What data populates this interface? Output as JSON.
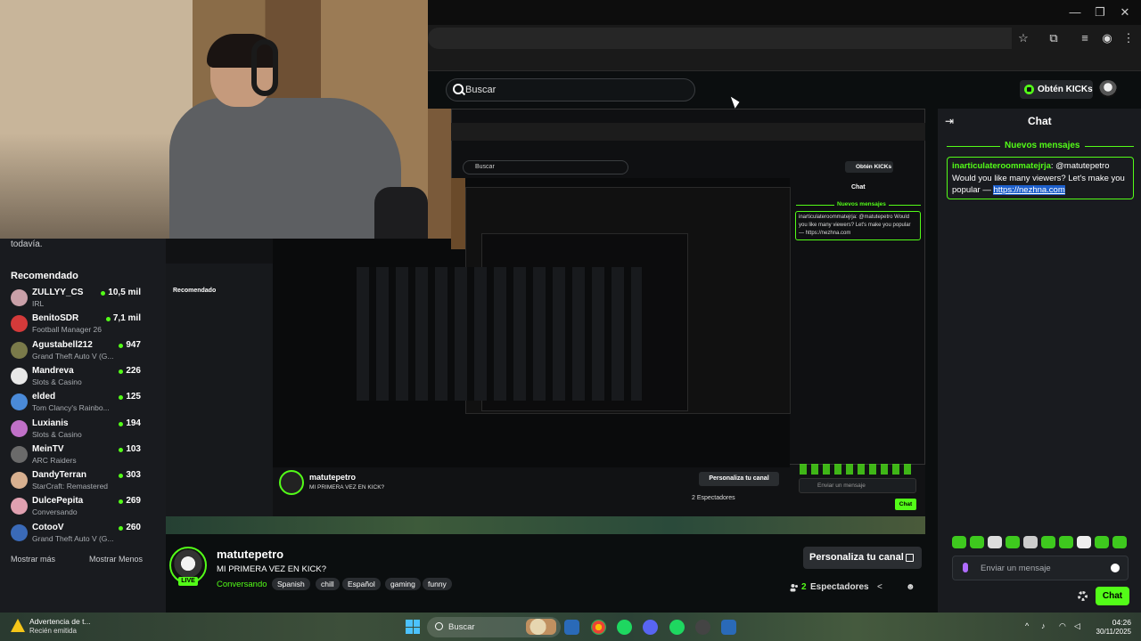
{
  "window": {
    "minimize": "—",
    "maximize": "❐",
    "close": "✕"
  },
  "kick": {
    "search_placeholder": "Buscar",
    "kicks_button": "Obtén KICKs"
  },
  "sidebar": {
    "remnant_text": "todavía.",
    "recommended_title": "Recomendado",
    "show_more": "Mostrar más",
    "show_less": "Mostrar Menos",
    "items": [
      {
        "name": "ZULLYY_CS",
        "game": "IRL",
        "viewers": "10,5 mil",
        "avatar_color": "#c9a0a8"
      },
      {
        "name": "BenitoSDR",
        "game": "Football Manager 26",
        "viewers": "7,1 mil",
        "avatar_color": "#d43a3a"
      },
      {
        "name": "Agustabell212",
        "game": "Grand Theft Auto V (G...",
        "viewers": "947",
        "avatar_color": "#7a7a4a"
      },
      {
        "name": "Mandreva",
        "game": "Slots & Casino",
        "viewers": "226",
        "avatar_color": "#e8e8e8"
      },
      {
        "name": "elded",
        "game": "Tom Clancy's Rainbo...",
        "viewers": "125",
        "avatar_color": "#4a8ad8"
      },
      {
        "name": "Luxianis",
        "game": "Slots & Casino",
        "viewers": "194",
        "avatar_color": "#c070c8"
      },
      {
        "name": "MeinTV",
        "game": "ARC Raiders",
        "viewers": "103",
        "avatar_color": "#6a6a6a"
      },
      {
        "name": "DandyTerran",
        "game": "StarCraft: Remastered",
        "viewers": "303",
        "avatar_color": "#d8b090"
      },
      {
        "name": "DulcePepita",
        "game": "Conversando",
        "viewers": "269",
        "avatar_color": "#e0a0b0"
      },
      {
        "name": "CotooV",
        "game": "Grand Theft Auto V (G...",
        "viewers": "260",
        "avatar_color": "#3a6ab8"
      }
    ]
  },
  "nested": {
    "search_label": "Buscar",
    "kicks_label": "Obtén KICKs",
    "chat_title": "Chat",
    "new_messages": "Nuevos mensajes",
    "chat_msg": "inarticulateroommatejrja: @matutepetro Would you like many viewers? Let's make you popular — https://nezhna.com",
    "sidebar_title": "Recomendado",
    "streamer_name": "matutepetro",
    "stream_title": "MI PRIMERA VEZ EN KICK?",
    "personaliza": "Personaliza tu canal",
    "viewers": "2 Espectadores",
    "input_placeholder": "Enviar un mensaje",
    "chat_button": "Chat"
  },
  "stream_info": {
    "streamer_name": "matutepetro",
    "live_label": "LIVE",
    "title": "MI PRIMERA VEZ EN KICK?",
    "category": "Conversando",
    "tags": [
      "Spanish",
      "chill",
      "Español",
      "gaming",
      "funny"
    ],
    "personaliza_button": "Personaliza tu canal",
    "viewers_count": "2",
    "viewers_label": "Espectadores"
  },
  "chat": {
    "title": "Chat",
    "new_messages_label": "Nuevos mensajes",
    "message_user": "inarticulateroommatejrja",
    "message_text_before": ": @matutepetro Would you like many viewers? Let's make you popular — ",
    "message_link": "https://nezhna.com",
    "input_placeholder": "Enviar un mensaje",
    "send_button": "Chat"
  },
  "taskbar": {
    "notification_title": "Advertencia de t...",
    "notification_sub": "Recién emitida",
    "search_label": "Buscar",
    "time": "04:26",
    "date": "30/11/2025"
  },
  "colors": {
    "accent": "#53fc18",
    "background": "#0b0e0f",
    "panel": "#191b1f"
  }
}
